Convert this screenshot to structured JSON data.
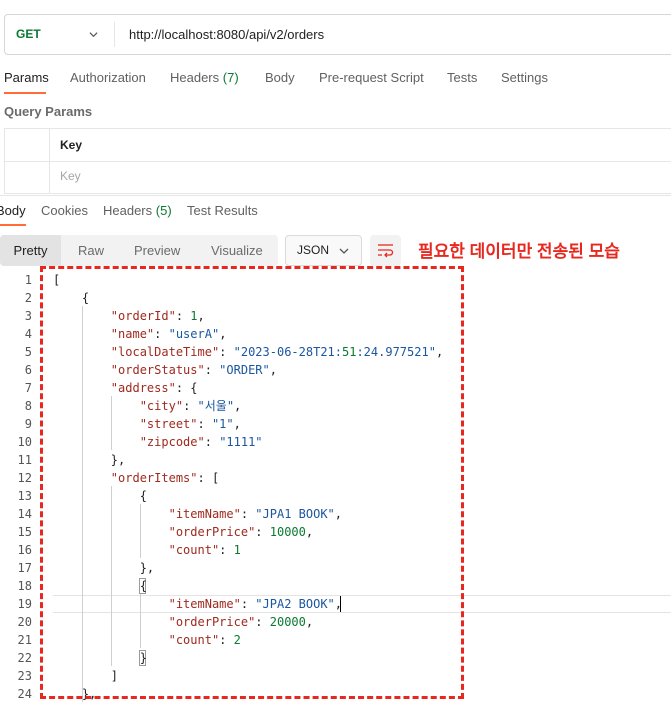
{
  "request": {
    "method": "GET",
    "url": "http://localhost:8080/api/v2/orders"
  },
  "request_tabs": [
    {
      "label": "Params",
      "count": ""
    },
    {
      "label": "Authorization",
      "count": ""
    },
    {
      "label": "Headers",
      "count": "(7)"
    },
    {
      "label": "Body",
      "count": ""
    },
    {
      "label": "Pre-request Script",
      "count": ""
    },
    {
      "label": "Tests",
      "count": ""
    },
    {
      "label": "Settings",
      "count": ""
    }
  ],
  "query_params": {
    "title": "Query Params",
    "header_key": "Key",
    "key_placeholder": "Key"
  },
  "response_tabs": [
    {
      "label": "Body",
      "count": ""
    },
    {
      "label": "Cookies",
      "count": ""
    },
    {
      "label": "Headers",
      "count": "(5)"
    },
    {
      "label": "Test Results",
      "count": ""
    }
  ],
  "view_modes": [
    "Pretty",
    "Raw",
    "Preview",
    "Visualize"
  ],
  "format_select": "JSON",
  "annotation": "필요한 데이터만 전송된 모습",
  "code_lines": [
    "[",
    "    {",
    "        \"orderId\": 1,",
    "        \"name\": \"userA\",",
    "        \"localDateTime\": \"2023-06-28T21:51:24.977521\",",
    "        \"orderStatus\": \"ORDER\",",
    "        \"address\": {",
    "            \"city\": \"서울\",",
    "            \"street\": \"1\",",
    "            \"zipcode\": \"1111\"",
    "        },",
    "        \"orderItems\": [",
    "            {",
    "                \"itemName\": \"JPA1 BOOK\",",
    "                \"orderPrice\": 10000,",
    "                \"count\": 1",
    "            },",
    "            {",
    "                \"itemName\": \"JPA2 BOOK\",",
    "                \"orderPrice\": 20000,",
    "                \"count\": 2",
    "            }",
    "        ]",
    "    },"
  ],
  "colors": {
    "accent": "#ff6c37",
    "method_green": "#0a7a32",
    "json_key": "#a02a1f",
    "json_string": "#1b57a0",
    "json_number": "#0a7a32",
    "annotation_red": "#e8281e"
  }
}
